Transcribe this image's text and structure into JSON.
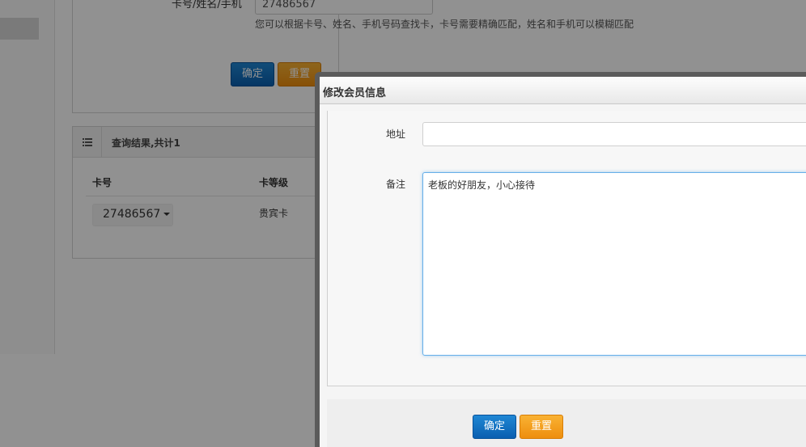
{
  "search": {
    "label": "卡号/姓名/手机",
    "value": "27486567",
    "hint": "您可以根据卡号、姓名、手机号码查找卡，卡号需要精确匹配，姓名和手机可以模糊匹配",
    "confirm_label": "确定",
    "reset_label": "重置"
  },
  "results": {
    "title": "查询结果,共计1",
    "icon": "list-icon",
    "columns": [
      "卡号",
      "卡等级"
    ],
    "rows": [
      {
        "card_no": "27486567",
        "level": "贵宾卡"
      }
    ]
  },
  "modal": {
    "title": "修改会员信息",
    "address_label": "地址",
    "address_value": "",
    "remark_label": "备注",
    "remark_value": "老板的好朋友，小心接待",
    "confirm_label": "确定",
    "reset_label": "重置"
  },
  "colors": {
    "primary_button": "#0a5fb0",
    "reset_button": "#ee8e0e",
    "focus_border": "#66afe9"
  }
}
